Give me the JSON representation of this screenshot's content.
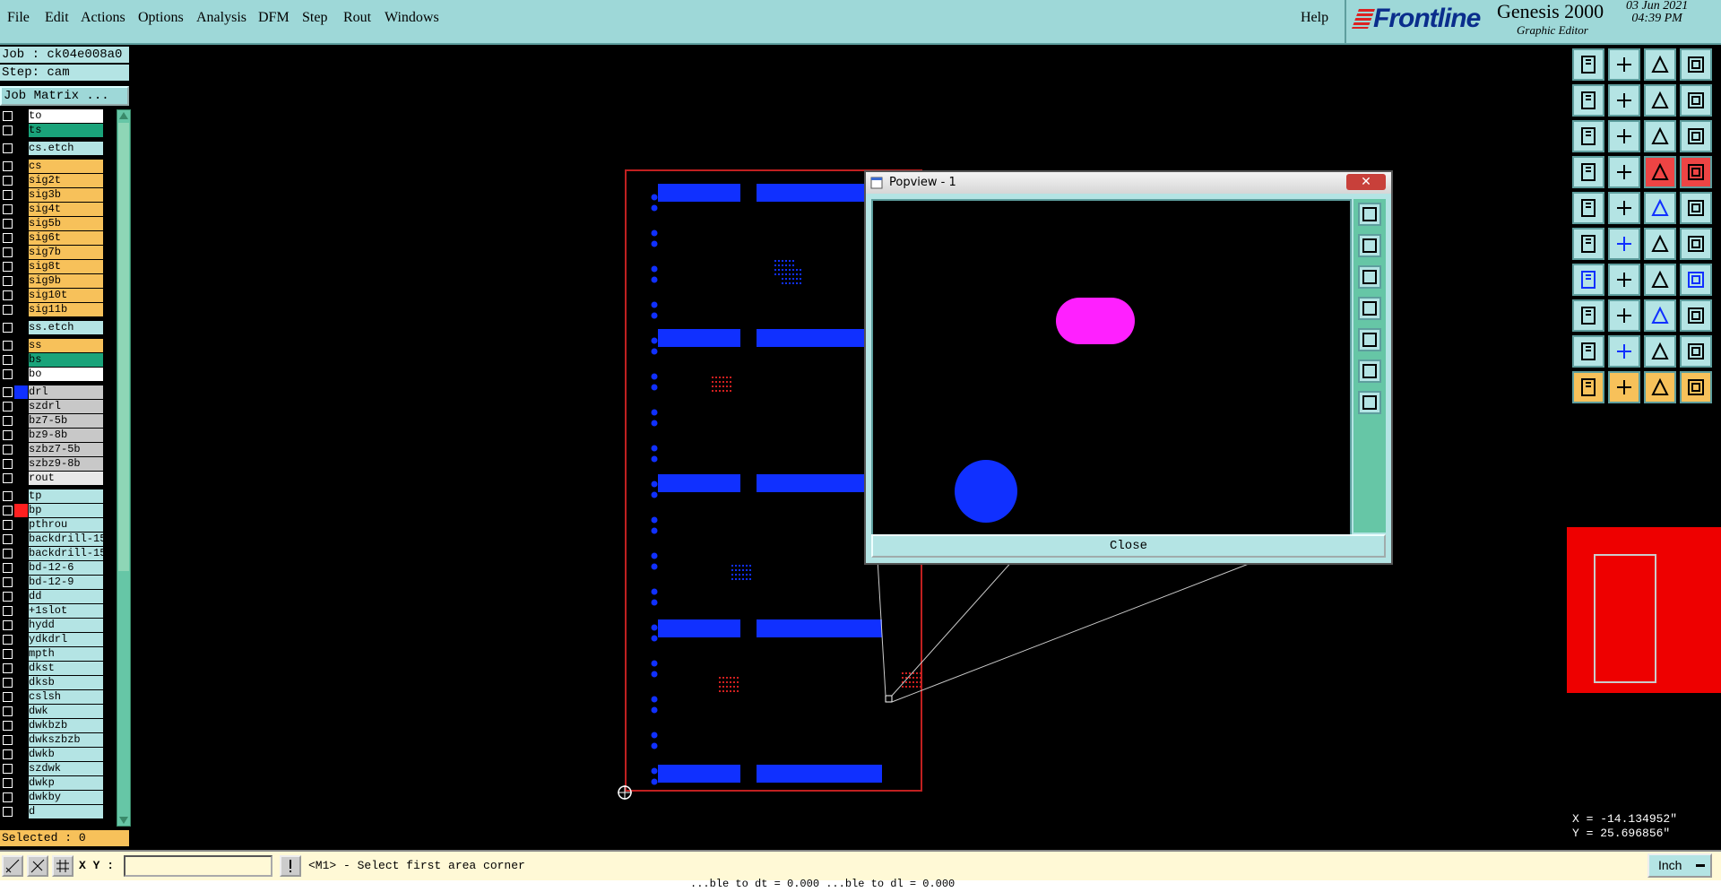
{
  "menu": {
    "items": [
      "File",
      "Edit",
      "Actions",
      "Options",
      "Analysis",
      "DFM",
      "Step",
      "Rout",
      "Windows"
    ],
    "help": "Help"
  },
  "brand": {
    "logo": "Frontline",
    "product": "Genesis 2000",
    "subtitle": "Graphic Editor",
    "date": "03 Jun 2021",
    "time": "04:39 PM"
  },
  "job": {
    "job_line": "Job : ck04e008a0",
    "step_line": "Step: cam",
    "matrix_button": "Job Matrix ..."
  },
  "layers": [
    {
      "name": "to",
      "bg": "#ffffff",
      "swatch": "#000000"
    },
    {
      "name": "ts",
      "bg": "#1aa37a",
      "swatch": "#000000"
    },
    {
      "name": "cs.etch",
      "bg": "#b4e4e4",
      "swatch": "#000000"
    },
    {
      "name": "cs",
      "bg": "#f7c15a",
      "swatch": "#000000"
    },
    {
      "name": "sig2t",
      "bg": "#f7c15a",
      "swatch": "#000000"
    },
    {
      "name": "sig3b",
      "bg": "#f7c15a",
      "swatch": "#000000"
    },
    {
      "name": "sig4t",
      "bg": "#f7c15a",
      "swatch": "#000000"
    },
    {
      "name": "sig5b",
      "bg": "#f7c15a",
      "swatch": "#000000"
    },
    {
      "name": "sig6t",
      "bg": "#f7c15a",
      "swatch": "#000000"
    },
    {
      "name": "sig7b",
      "bg": "#f7c15a",
      "swatch": "#000000"
    },
    {
      "name": "sig8t",
      "bg": "#f7c15a",
      "swatch": "#000000"
    },
    {
      "name": "sig9b",
      "bg": "#f7c15a",
      "swatch": "#000000"
    },
    {
      "name": "sig10t",
      "bg": "#f7c15a",
      "swatch": "#000000"
    },
    {
      "name": "sig11b",
      "bg": "#f7c15a",
      "swatch": "#000000"
    },
    {
      "name": "ss.etch",
      "bg": "#b4e4e4",
      "swatch": "#000000"
    },
    {
      "name": "ss",
      "bg": "#f7c15a",
      "swatch": "#000000"
    },
    {
      "name": "bs",
      "bg": "#1aa37a",
      "swatch": "#000000"
    },
    {
      "name": "bo",
      "bg": "#ffffff",
      "swatch": "#000000"
    },
    {
      "name": "drl",
      "bg": "#c8c8c8",
      "swatch": "#1030ff"
    },
    {
      "name": "szdrl",
      "bg": "#c8c8c8",
      "swatch": "#000000"
    },
    {
      "name": "bz7-5b",
      "bg": "#c8c8c8",
      "swatch": "#000000"
    },
    {
      "name": "bz9-8b",
      "bg": "#c8c8c8",
      "swatch": "#000000"
    },
    {
      "name": "szbz7-5b",
      "bg": "#c8c8c8",
      "swatch": "#000000"
    },
    {
      "name": "szbz9-8b",
      "bg": "#c8c8c8",
      "swatch": "#000000"
    },
    {
      "name": "rout",
      "bg": "#e8e8e8",
      "swatch": "#000000"
    },
    {
      "name": "tp",
      "bg": "#b4e4e4",
      "swatch": "#000000"
    },
    {
      "name": "bp",
      "bg": "#b4e4e4",
      "swatch": "#ff2020"
    },
    {
      "name": "pthrou",
      "bg": "#b4e4e4",
      "swatch": "#000000"
    },
    {
      "name": "backdrill-15",
      "bg": "#b4e4e4",
      "swatch": "#000000"
    },
    {
      "name": "backdrill-15",
      "bg": "#b4e4e4",
      "swatch": "#000000"
    },
    {
      "name": "bd-12-6",
      "bg": "#b4e4e4",
      "swatch": "#000000"
    },
    {
      "name": "bd-12-9",
      "bg": "#b4e4e4",
      "swatch": "#000000"
    },
    {
      "name": "dd",
      "bg": "#b4e4e4",
      "swatch": "#000000"
    },
    {
      "name": "+1slot",
      "bg": "#b4e4e4",
      "swatch": "#000000"
    },
    {
      "name": "hydd",
      "bg": "#b4e4e4",
      "swatch": "#000000"
    },
    {
      "name": "ydkdrl",
      "bg": "#b4e4e4",
      "swatch": "#000000"
    },
    {
      "name": "mpth",
      "bg": "#b4e4e4",
      "swatch": "#000000"
    },
    {
      "name": "dkst",
      "bg": "#b4e4e4",
      "swatch": "#000000"
    },
    {
      "name": "dksb",
      "bg": "#b4e4e4",
      "swatch": "#000000"
    },
    {
      "name": "cslsh",
      "bg": "#b4e4e4",
      "swatch": "#000000"
    },
    {
      "name": "dwk",
      "bg": "#b4e4e4",
      "swatch": "#000000"
    },
    {
      "name": "dwkbzb",
      "bg": "#b4e4e4",
      "swatch": "#000000"
    },
    {
      "name": "dwkszbzb",
      "bg": "#b4e4e4",
      "swatch": "#000000"
    },
    {
      "name": "dwkb",
      "bg": "#b4e4e4",
      "swatch": "#000000"
    },
    {
      "name": "szdwk",
      "bg": "#b4e4e4",
      "swatch": "#000000"
    },
    {
      "name": "dwkp",
      "bg": "#b4e4e4",
      "swatch": "#000000"
    },
    {
      "name": "dwkby",
      "bg": "#b4e4e4",
      "swatch": "#000000"
    },
    {
      "name": "d",
      "bg": "#b4e4e4",
      "swatch": "#000000"
    }
  ],
  "selected": "Selected : 0",
  "tools": [
    "save-job-icon",
    "close-job-icon",
    "home-icon",
    "zoom-home-icon",
    "prev-step-icon",
    "next-step-icon",
    "undo-icon",
    "redo-icon",
    "fit-all-icon",
    "zoom-in-icon",
    "scale-1-2-icon",
    "help-icon",
    "measure-icon",
    "grid-icon",
    "snap-icon",
    "snap-center-icon",
    "add-pad-icon",
    "add-line-icon",
    "add-surface-icon",
    "add-text-icon",
    "connect-icon",
    "delete-icon",
    "move-icon",
    "copy-icon",
    "rotate-icon",
    "mirror-icon",
    "undo-edit-icon",
    "features-icon",
    "select-icon",
    "cut-icon",
    "resize-icon",
    "transform-icon",
    "polygon-icon",
    "polygon-add-icon",
    "polygon-sub-icon",
    "polygon-edit-icon",
    "pointer-icon",
    "pointer-select-icon",
    "pointer-area-icon",
    "pointer-multi-icon"
  ],
  "coords": {
    "x": "X = -14.134952\"",
    "y": "Y = 25.696856\""
  },
  "bottom": {
    "xy_label": "X Y :",
    "xy_value": "",
    "prompt": "<M1> - Select first area corner",
    "unit": "Inch"
  },
  "status_line": "...ble to dt = 0.000    ...ble to dl = 0.000",
  "popview": {
    "title": "Popview - 1",
    "close": "Close"
  },
  "colors": {
    "menu_bg": "#9ed8d8",
    "accent": "#b4e4e4",
    "board_outline": "#d02020",
    "pad_blue": "#1030ff",
    "pad_magenta": "#ff20ff"
  }
}
